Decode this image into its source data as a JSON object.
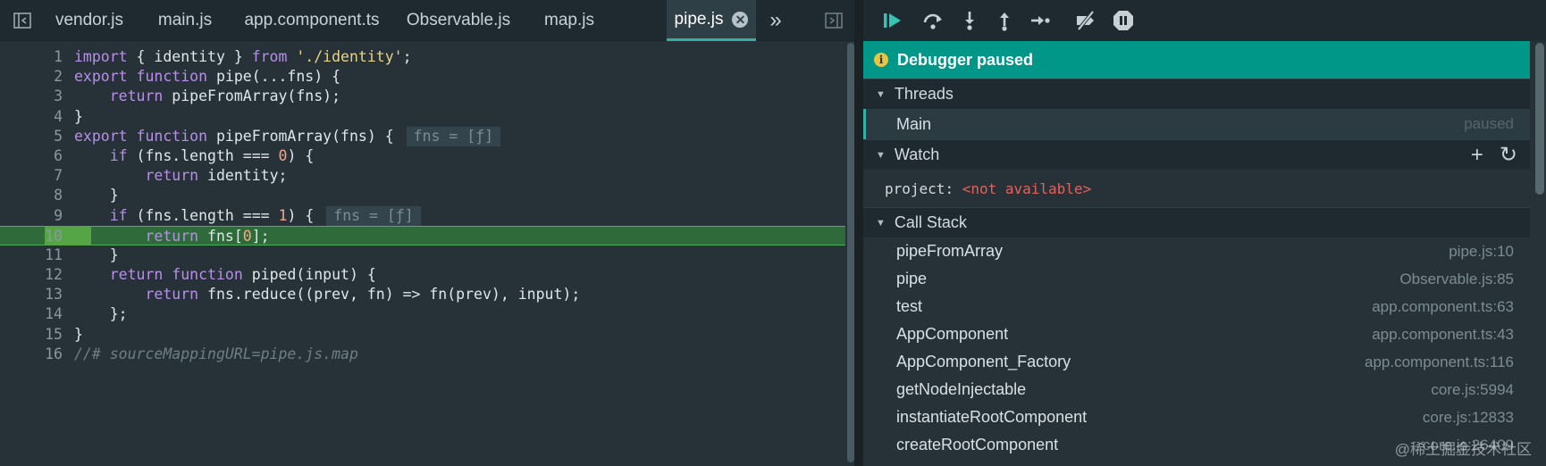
{
  "tabs": [
    {
      "label": "vendor.js",
      "active": false
    },
    {
      "label": "main.js",
      "active": false
    },
    {
      "label": "app.component.ts",
      "active": false
    },
    {
      "label": "Observable.js",
      "active": false
    },
    {
      "label": "map.js",
      "active": false
    },
    {
      "label": "pipe.js",
      "active": true
    }
  ],
  "tab_close_glyph": "✕",
  "tab_more_glyph": "»",
  "code": {
    "current_line": 10,
    "lines": [
      {
        "n": "1",
        "segs": [
          [
            "kw",
            "import"
          ],
          [
            "t",
            " { identity } "
          ],
          [
            "kw",
            "from"
          ],
          [
            "t",
            " "
          ],
          [
            "str",
            "'./identity'"
          ],
          [
            "t",
            ";"
          ]
        ]
      },
      {
        "n": "2",
        "segs": [
          [
            "kw",
            "export"
          ],
          [
            "t",
            " "
          ],
          [
            "kw",
            "function"
          ],
          [
            "t",
            " pipe(...fns) {"
          ]
        ]
      },
      {
        "n": "3",
        "segs": [
          [
            "t",
            "    "
          ],
          [
            "kw",
            "return"
          ],
          [
            "t",
            " pipeFromArray(fns);"
          ]
        ]
      },
      {
        "n": "4",
        "segs": [
          [
            "t",
            "}"
          ]
        ]
      },
      {
        "n": "5",
        "segs": [
          [
            "kw",
            "export"
          ],
          [
            "t",
            " "
          ],
          [
            "kw",
            "function"
          ],
          [
            "t",
            " pipeFromArray(fns) {"
          ],
          [
            "iv",
            "fns = [ƒ]"
          ]
        ]
      },
      {
        "n": "6",
        "segs": [
          [
            "t",
            "    "
          ],
          [
            "kw",
            "if"
          ],
          [
            "t",
            " (fns.length === "
          ],
          [
            "num",
            "0"
          ],
          [
            "t",
            ") {"
          ]
        ]
      },
      {
        "n": "7",
        "segs": [
          [
            "t",
            "        "
          ],
          [
            "kw",
            "return"
          ],
          [
            "t",
            " identity;"
          ]
        ]
      },
      {
        "n": "8",
        "segs": [
          [
            "t",
            "    }"
          ]
        ]
      },
      {
        "n": "9",
        "segs": [
          [
            "t",
            "    "
          ],
          [
            "kw",
            "if"
          ],
          [
            "t",
            " (fns.length === "
          ],
          [
            "num",
            "1"
          ],
          [
            "t",
            ") {"
          ],
          [
            "iv",
            "fns = [ƒ]"
          ]
        ]
      },
      {
        "n": "10",
        "segs": [
          [
            "t",
            "        "
          ],
          [
            "kw",
            "return"
          ],
          [
            "t",
            " fns["
          ],
          [
            "num",
            "0"
          ],
          [
            "t",
            "];"
          ]
        ]
      },
      {
        "n": "11",
        "segs": [
          [
            "t",
            "    }"
          ]
        ]
      },
      {
        "n": "12",
        "segs": [
          [
            "t",
            "    "
          ],
          [
            "kw",
            "return"
          ],
          [
            "t",
            " "
          ],
          [
            "kw",
            "function"
          ],
          [
            "t",
            " piped(input) {"
          ]
        ]
      },
      {
        "n": "13",
        "segs": [
          [
            "t",
            "        "
          ],
          [
            "kw",
            "return"
          ],
          [
            "t",
            " fns.reduce((prev, fn) => fn(prev), input);"
          ]
        ]
      },
      {
        "n": "14",
        "segs": [
          [
            "t",
            "    };"
          ]
        ]
      },
      {
        "n": "15",
        "segs": [
          [
            "t",
            "}"
          ]
        ]
      },
      {
        "n": "16",
        "segs": [
          [
            "cmt",
            "//# sourceMappingURL=pipe.js.map"
          ]
        ]
      }
    ]
  },
  "debugger": {
    "banner": "Debugger paused",
    "banner_icon": "info-icon",
    "toolbar_icons": [
      "resume-icon",
      "step-over-icon",
      "step-in-icon",
      "step-out-icon",
      "step-icon",
      "deactivate-breakpoints-icon",
      "pause-on-exceptions-icon"
    ],
    "threads": {
      "title": "Threads",
      "items": [
        {
          "name": "Main",
          "status": "paused"
        }
      ]
    },
    "watch": {
      "title": "Watch",
      "add_glyph": "+",
      "refresh_glyph": "↻",
      "items": [
        {
          "name": "project",
          "value": "<not available>"
        }
      ]
    },
    "call_stack": {
      "title": "Call Stack",
      "frames": [
        {
          "name": "pipeFromArray",
          "loc": "pipe.js:10"
        },
        {
          "name": "pipe",
          "loc": "Observable.js:85"
        },
        {
          "name": "test",
          "loc": "app.component.ts:63"
        },
        {
          "name": "AppComponent",
          "loc": "app.component.ts:43"
        },
        {
          "name": "AppComponent_Factory",
          "loc": "app.component.ts:116"
        },
        {
          "name": "getNodeInjectable",
          "loc": "core.js:5994"
        },
        {
          "name": "instantiateRootComponent",
          "loc": "core.js:12833"
        },
        {
          "name": "createRootComponent",
          "loc": "core.js:26409"
        }
      ]
    }
  },
  "watermark": "@稀土掘金技术社区",
  "colors": {
    "accent": "#35b0a6",
    "banner": "#009688",
    "current_line": "#2f6b3a",
    "error_value": "#e5605b"
  }
}
